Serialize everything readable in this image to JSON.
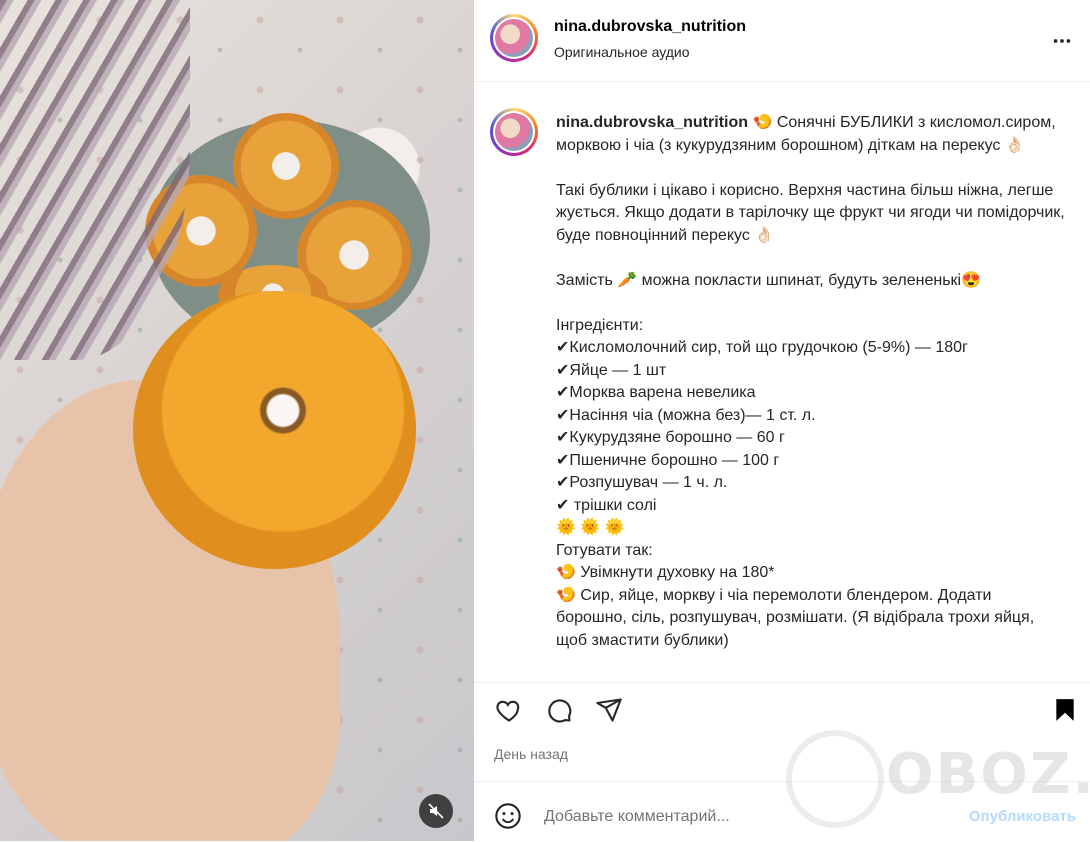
{
  "post": {
    "username": "nina.dubrovska_nutrition",
    "audio_label": "Оригинальное аудио",
    "caption_lines": [
      "🍤 Сонячні БУБЛИКИ з кисломол.сиром, морквою і чіа (з кукурудзяним борошном) діткам на перекус 👌🏻",
      "",
      "Такі бублики і цікаво і корисно. Верхня частина більш ніжна, легше жується. Якщо додати в тарілочку ще фрукт чи ягоди чи помідорчик, буде повноцінний перекус 👌🏻",
      "",
      "Замість 🥕 можна покласти шпинат, будуть зелененькі😍",
      "",
      "Інгредієнти:",
      "✔Кисломолочний сир, той що грудочкою (5-9%) — 180г",
      "✔Яйце — 1 шт",
      "✔Морква варена невелика",
      "✔Насіння чіа (можна без)— 1 ст. л.",
      "✔Кукурудзяне борошно — 60 г",
      "✔Пшеничне борошно — 100 г",
      "✔Розпушувач — 1 ч. л.",
      "✔ трішки солі",
      "🌞 🌞 🌞",
      "Готувати так:",
      "🍤 Увімкнути духовку на 180*",
      "🍤 Сир, яйце, моркву і чіа перемолоти блендером. Додати борошно, сіль, розпушувач, розмішати. (Я відібрала трохи яйця, щоб змастити бублики)"
    ],
    "time_label": "День назад"
  },
  "comment": {
    "placeholder": "Добавьте комментарий...",
    "post_label": "Опубликовать"
  },
  "watermark": {
    "text": "OBOZ.UA"
  },
  "icons": {
    "more": "more-horizontal-icon",
    "like": "heart-icon",
    "comment": "comment-icon",
    "share": "send-icon",
    "save": "bookmark-icon",
    "emoji": "emoji-icon",
    "mute": "muted-speaker-icon"
  },
  "colors": {
    "accent": "#0095f6",
    "check": "#8a5bd6",
    "muted_text": "#737373"
  }
}
